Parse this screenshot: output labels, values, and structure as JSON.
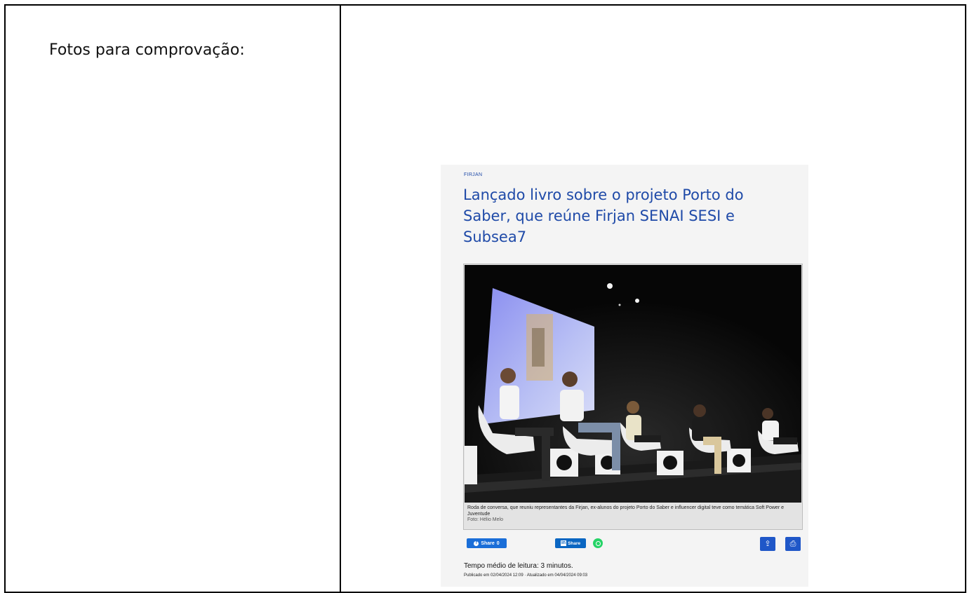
{
  "document": {
    "label": "Fotos para comprovação:"
  },
  "article": {
    "kicker": "FIRJAN",
    "headline": "Lançado livro sobre o projeto Porto do Saber, que reúne Firjan SENAI SESI e Subsea7",
    "caption": "Roda de conversa, que reuniu representantes da Firjan, ex-alunos do projeto Porto do Saber e influencer digital teve como temática Soft Power e Juventude",
    "photo_credit": "Foto: Hélio Melo",
    "share": {
      "facebook_label": "Share",
      "facebook_count": "0",
      "linkedin_logo": "in",
      "linkedin_label": "Share"
    },
    "icons": [
      "facebook-icon",
      "linkedin-icon",
      "whatsapp-icon",
      "share-icon",
      "print-icon"
    ],
    "reading_time": "Tempo médio de leitura: 3 minutos.",
    "dates": "Publicado em 02/04/2024 12:09  ·  Atualizado em  04/04/2024 09:03",
    "colors": {
      "accent": "#1f4aa8",
      "facebook": "#1a6ed8",
      "linkedin": "#0a66c2",
      "whatsapp": "#25d366",
      "action_button": "#1f57c8"
    }
  }
}
